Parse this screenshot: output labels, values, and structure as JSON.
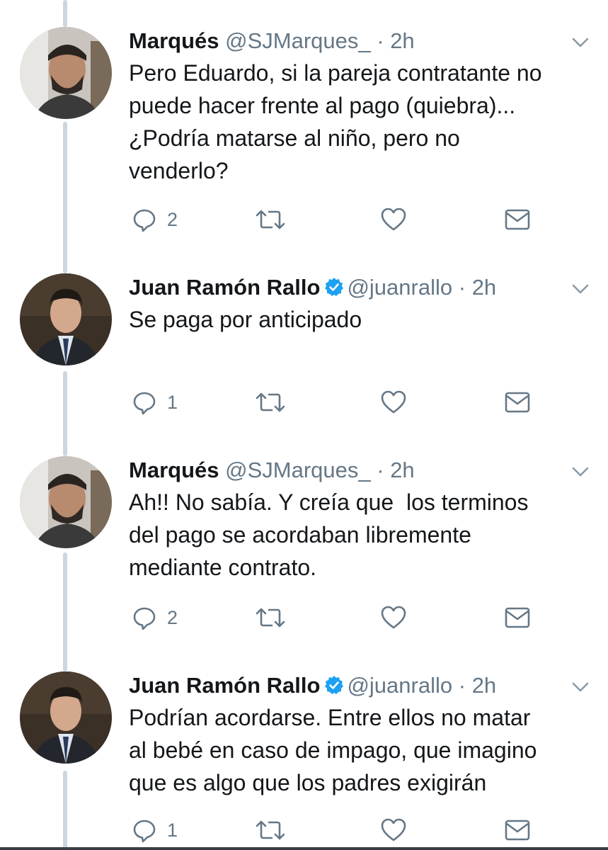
{
  "tweets": [
    {
      "name": "Marqués",
      "handle": "@SJMarques_",
      "separator": "·",
      "time": "2h",
      "verified": false,
      "avatar": "marques-avatar",
      "text": "Pero Eduardo, si la pareja contratante no\npuede hacer frente al pago (quiebra)...\n¿Podría matarse al niño, pero no\nvenderlo?",
      "reply_count": "2"
    },
    {
      "name": "Juan Ramón Rallo",
      "handle": "@juanrallo",
      "separator": "·",
      "time": "2h",
      "verified": true,
      "avatar": "rallo-avatar",
      "text": "Se paga por anticipado",
      "reply_count": "1"
    },
    {
      "name": "Marqués",
      "handle": "@SJMarques_",
      "separator": "·",
      "time": "2h",
      "verified": false,
      "avatar": "marques-avatar",
      "text": "Ah!! No sabía. Y creía que  los terminos\ndel pago se acordaban libremente\nmediante contrato.",
      "reply_count": "2"
    },
    {
      "name": "Juan Ramón Rallo",
      "handle": "@juanrallo",
      "separator": "·",
      "time": "2h",
      "verified": true,
      "avatar": "rallo-avatar",
      "text": "Podrían acordarse. Entre ellos no matar\nal bebé en caso de impago, que imagino\nque es algo que los padres exigirán",
      "reply_count": "1"
    }
  ],
  "icons": {
    "reply": "reply-icon",
    "retweet": "retweet-icon",
    "like": "heart-icon",
    "dm": "envelope-icon",
    "menu": "chevron-down-icon",
    "verified": "verified-badge-icon"
  },
  "colors": {
    "text": "#14171a",
    "secondary": "#657786",
    "verified": "#1da1f2",
    "thread_line": "#ccd6dd"
  }
}
